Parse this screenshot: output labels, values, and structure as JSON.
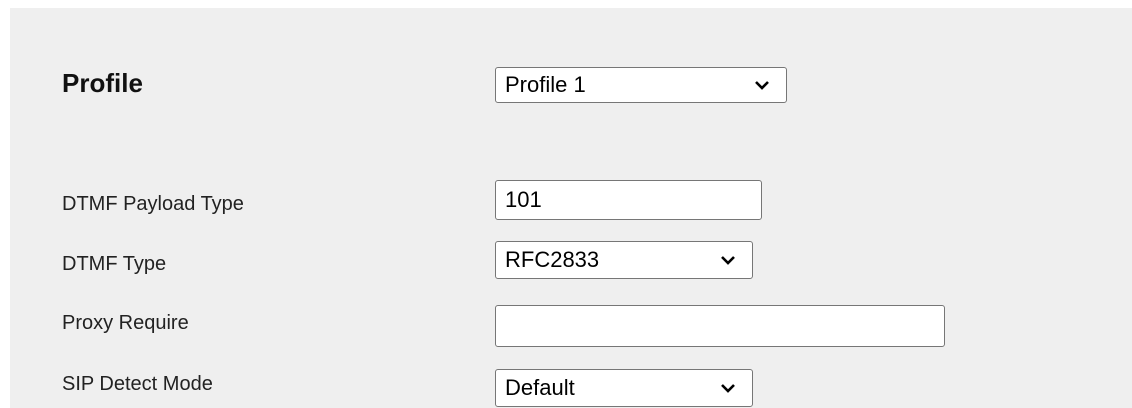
{
  "profile": {
    "title": "Profile",
    "selected": "Profile 1"
  },
  "fields": {
    "dtmf_payload_type": {
      "label": "DTMF Payload Type",
      "value": "101"
    },
    "dtmf_type": {
      "label": "DTMF Type",
      "selected": "RFC2833"
    },
    "proxy_require": {
      "label": "Proxy Require",
      "value": ""
    },
    "sip_detect_mode": {
      "label": "SIP Detect Mode",
      "selected": "Default"
    }
  },
  "icons": {
    "dropdown": "chevron-down-icon"
  }
}
